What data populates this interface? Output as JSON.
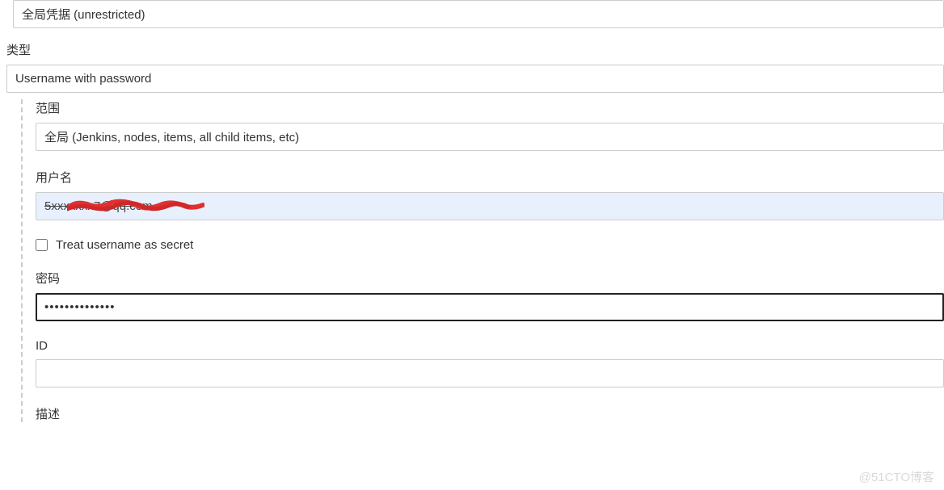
{
  "domain_select": {
    "value": "全局凭据 (unrestricted)"
  },
  "type": {
    "label": "类型",
    "value": "Username with password"
  },
  "scope": {
    "label": "范围",
    "value": "全局 (Jenkins, nodes, items, all child items, etc)"
  },
  "username": {
    "label": "用户名",
    "value_visible_fragment": "@qq.com",
    "value_masked": "5xxxxxxx7@qq.com"
  },
  "treat_secret": {
    "label": "Treat username as secret",
    "checked": false
  },
  "password": {
    "label": "密码",
    "value": "••••••••••••••"
  },
  "id": {
    "label": "ID",
    "value": ""
  },
  "description": {
    "label": "描述"
  },
  "watermark": "@51CTO博客"
}
